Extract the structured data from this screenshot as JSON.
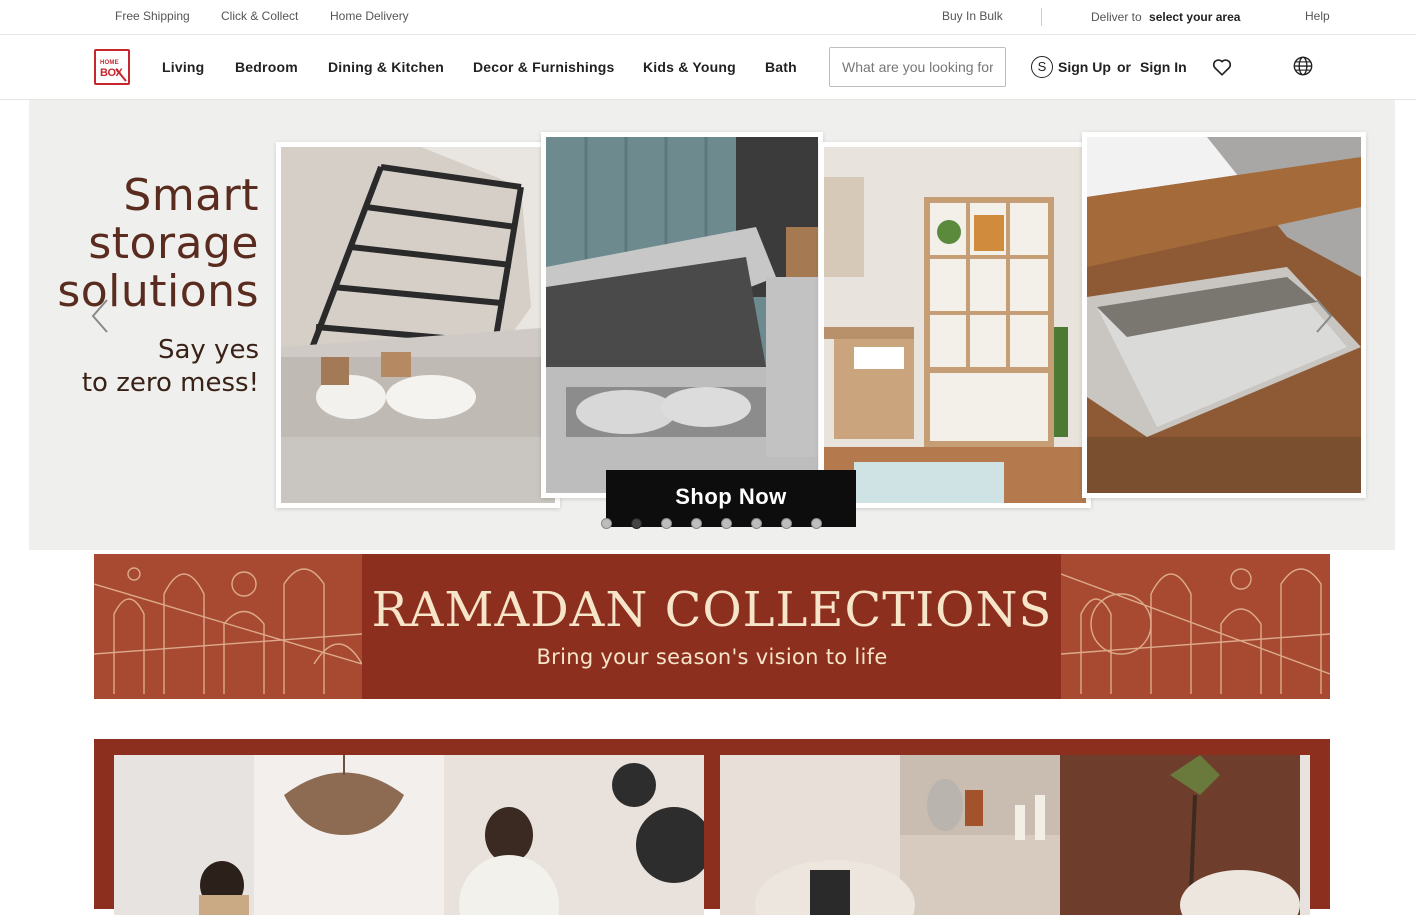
{
  "topbar": {
    "free_shipping": "Free Shipping",
    "click_collect": "Click & Collect",
    "home_delivery": "Home Delivery",
    "buy_in_bulk": "Buy In Bulk",
    "deliver_to": "Deliver to",
    "select_area": "select your area",
    "help": "Help"
  },
  "logo": {
    "line1": "HOME",
    "line2": "BOX"
  },
  "nav": {
    "items": [
      {
        "label": "Living"
      },
      {
        "label": "Bedroom"
      },
      {
        "label": "Dining & Kitchen"
      },
      {
        "label": "Decor & Furnishings"
      },
      {
        "label": "Kids & Young"
      },
      {
        "label": "Bath"
      }
    ]
  },
  "search": {
    "placeholder": "What are you looking for?"
  },
  "account": {
    "sign_up": "Sign Up",
    "or": "or",
    "sign_in": "Sign In",
    "icon": "user-s-icon"
  },
  "icons": {
    "wishlist": "heart-icon",
    "language": "globe-icon",
    "prev": "chevron-left-icon",
    "next": "chevron-right-icon"
  },
  "hero": {
    "title_lines": [
      "Smart",
      "storage",
      "solutions"
    ],
    "sub_lines": [
      "Say yes",
      "to zero mess!"
    ],
    "cta": "Shop Now",
    "slide_count": 8,
    "active_slide": 2
  },
  "ramadan": {
    "title": "RAMADAN COLLECTIONS",
    "subtitle": "Bring your season's vision to life"
  },
  "colors": {
    "brand": "#c8262e",
    "ramadan_bg": "#8d2f1f",
    "ramadan_text": "#f6e5c8",
    "hero_bg": "#efefed",
    "hero_title": "#5a2c1f"
  }
}
